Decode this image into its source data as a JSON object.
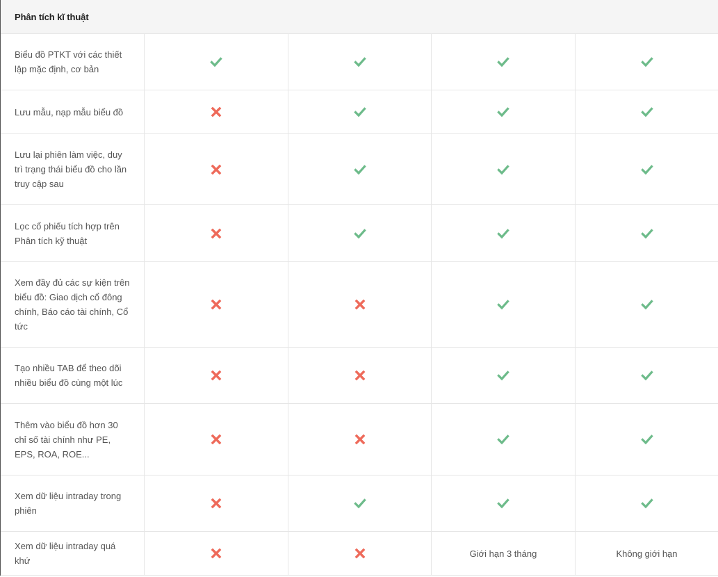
{
  "section": {
    "title": "Phân tích kĩ thuật"
  },
  "colors": {
    "check": "#6dbb8a",
    "cross": "#ee6a5a"
  },
  "icons": {
    "yes": "check-icon",
    "no": "cross-icon"
  },
  "rows": [
    {
      "feature": "Biểu đồ PTKT với các thiết lập mặc định, cơ bản",
      "values": [
        "yes",
        "yes",
        "yes",
        "yes"
      ]
    },
    {
      "feature": "Lưu mẫu, nạp mẫu biểu đồ",
      "values": [
        "no",
        "yes",
        "yes",
        "yes"
      ]
    },
    {
      "feature": "Lưu lại phiên làm việc, duy trì trạng thái biểu đồ cho lần truy cập sau",
      "values": [
        "no",
        "yes",
        "yes",
        "yes"
      ]
    },
    {
      "feature": "Lọc cổ phiếu tích hợp trên Phân tích kỹ thuật",
      "values": [
        "no",
        "yes",
        "yes",
        "yes"
      ]
    },
    {
      "feature": "Xem đầy đủ các sự kiện trên biểu đồ: Giao dịch cổ đông chính, Báo cáo tài chính, Cổ tức",
      "values": [
        "no",
        "no",
        "yes",
        "yes"
      ]
    },
    {
      "feature": "Tạo nhiều TAB để theo dõi nhiều biểu đồ cùng một lúc",
      "values": [
        "no",
        "no",
        "yes",
        "yes"
      ]
    },
    {
      "feature": "Thêm vào biểu đồ hơn 30 chỉ số tài chính như PE, EPS, ROA, ROE...",
      "values": [
        "no",
        "no",
        "yes",
        "yes"
      ]
    },
    {
      "feature": "Xem dữ liệu intraday trong phiên",
      "values": [
        "no",
        "yes",
        "yes",
        "yes"
      ]
    },
    {
      "feature": "Xem dữ liệu intraday quá khứ",
      "values": [
        "no",
        "no",
        "Giới hạn 3 tháng",
        "Không giới hạn"
      ]
    }
  ]
}
